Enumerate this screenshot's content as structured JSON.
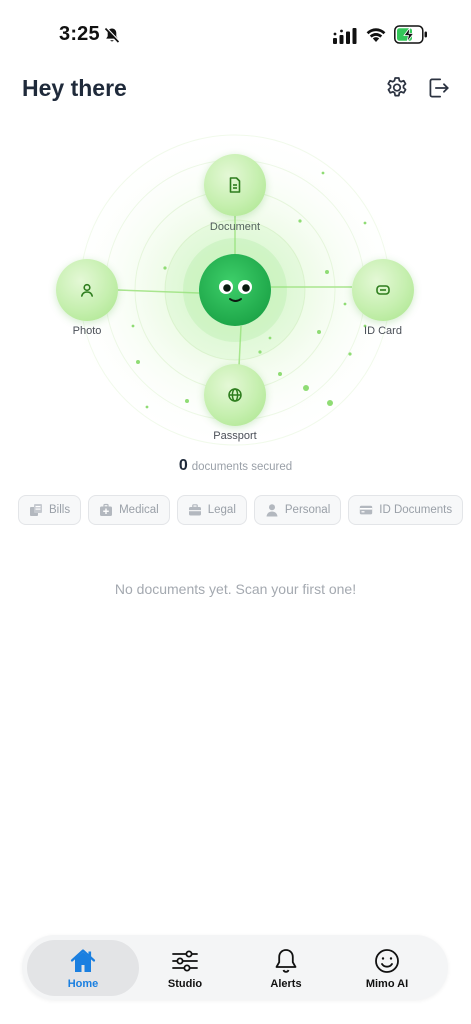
{
  "status_bar": {
    "time": "3:25"
  },
  "header": {
    "title": "Hey there"
  },
  "orbit": {
    "nodes": [
      {
        "label": "Document",
        "icon": "document-icon"
      },
      {
        "label": "Photo",
        "icon": "person-icon"
      },
      {
        "label": "ID Card",
        "icon": "id-card-icon"
      },
      {
        "label": "Passport",
        "icon": "globe-icon"
      }
    ]
  },
  "summary": {
    "count": "0",
    "label": "documents secured"
  },
  "filters": [
    {
      "label": "Bills",
      "icon": "receipt-icon"
    },
    {
      "label": "Medical",
      "icon": "medical-kit-icon"
    },
    {
      "label": "Legal",
      "icon": "briefcase-icon"
    },
    {
      "label": "Personal",
      "icon": "person-icon"
    },
    {
      "label": "ID Documents",
      "icon": "card-icon"
    }
  ],
  "empty_state": {
    "message": "No documents yet. Scan your first one!"
  },
  "tabbar": {
    "tabs": [
      {
        "label": "Home",
        "icon": "home-icon",
        "active": true
      },
      {
        "label": "Studio",
        "icon": "sliders-icon"
      },
      {
        "label": "Alerts",
        "icon": "bell-icon"
      },
      {
        "label": "Mimo AI",
        "icon": "smiley-icon"
      }
    ]
  },
  "colors": {
    "accent": "#1a7fe0",
    "mascot": "#1fa84a",
    "node": "#c5efae",
    "text": "#1f2a3a"
  }
}
